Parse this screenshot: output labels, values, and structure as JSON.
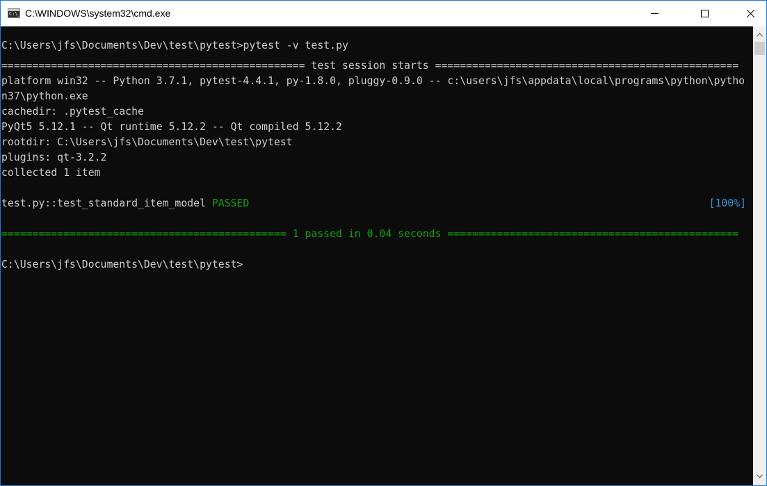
{
  "window": {
    "title": "C:\\WINDOWS\\system32\\cmd.exe",
    "icon_glyph": "C:\\_",
    "icon": "cmd-icon",
    "controls": {
      "minimize": "minimize-icon",
      "maximize": "maximize-icon",
      "close": "close-icon"
    }
  },
  "colors": {
    "background": "#0c0c0c",
    "text": "#cccccc",
    "pass_green": "#13a10e",
    "percent_cyan": "#3a96dd",
    "window_border": "#1e7bd6"
  },
  "console": {
    "prompt_1": "C:\\Users\\jfs\\Documents\\Dev\\test\\pytest>",
    "command_1": "pytest -v test.py",
    "session_header": "================================================= test session starts =================================================",
    "platform_line_1": "platform win32 -- Python 3.7.1, pytest-4.4.1, py-1.8.0, pluggy-0.9.0 -- c:\\users\\jfs\\appdata\\local\\programs\\python\\pytho",
    "platform_line_2": "n37\\python.exe",
    "cachedir": "cachedir: .pytest_cache",
    "pyqt": "PyQt5 5.12.1 -- Qt runtime 5.12.2 -- Qt compiled 5.12.2",
    "rootdir": "rootdir: C:\\Users\\jfs\\Documents\\Dev\\test\\pytest",
    "plugins": "plugins: qt-3.2.2",
    "collected": "collected 1 item",
    "test_name": "test.py::test_standard_item_model ",
    "test_result": "PASSED",
    "test_percent": "[100%]",
    "summary": "============================================== 1 passed in 0.04 seconds ===============================================",
    "prompt_2": "C:\\Users\\jfs\\Documents\\Dev\\test\\pytest>"
  }
}
